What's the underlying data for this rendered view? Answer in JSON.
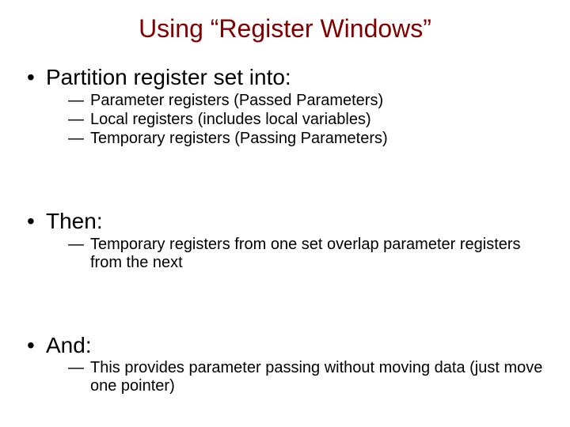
{
  "title": "Using “Register Windows”",
  "sections": [
    {
      "heading": "Partition register set into:",
      "items": [
        " Parameter registers (Passed Parameters)",
        " Local registers (includes local variables)",
        "Temporary registers (Passing Parameters)"
      ]
    },
    {
      "heading": "Then:",
      "items": [
        "Temporary registers from one set overlap parameter registers from the next"
      ]
    },
    {
      "heading": "And:",
      "items": [
        "This provides parameter passing without moving data (just move one pointer)"
      ]
    }
  ]
}
